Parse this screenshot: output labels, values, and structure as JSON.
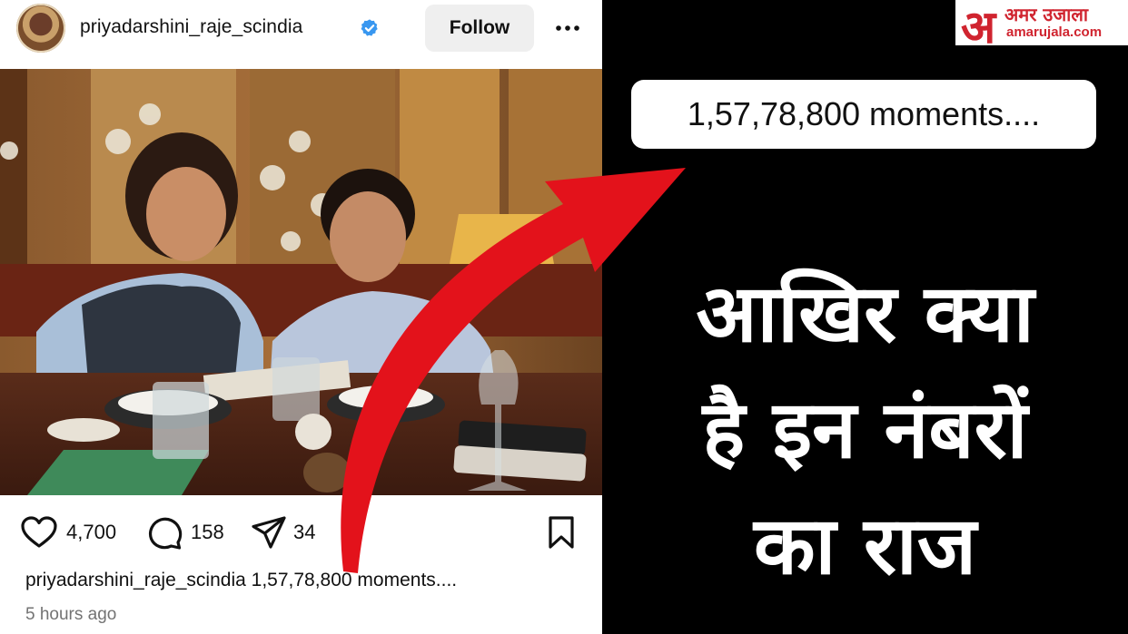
{
  "post": {
    "username": "priyadarshini_raje_scindia",
    "follow_label": "Follow",
    "likes": "4,700",
    "comments": "158",
    "shares": "34",
    "caption_user": "priyadarshini_raje_scindia",
    "caption_text": "1,57,78,800 moments....",
    "timestamp": "5 hours ago"
  },
  "right_panel": {
    "logo_hindi": "अमर उजाला",
    "logo_domain": "amarujala.com",
    "logo_mark": "अ",
    "moments_text": "1,57,78,800 moments....",
    "headline_lines": [
      "आखिर क्या",
      "है इन नंबरों",
      "का राज"
    ]
  },
  "colors": {
    "accent_red": "#e3121b",
    "verified_blue": "#3897f0",
    "brand_red": "#d0242f"
  },
  "icons": [
    "verified-badge-icon",
    "more-options-icon",
    "heart-icon",
    "comment-icon",
    "share-icon",
    "bookmark-icon"
  ]
}
